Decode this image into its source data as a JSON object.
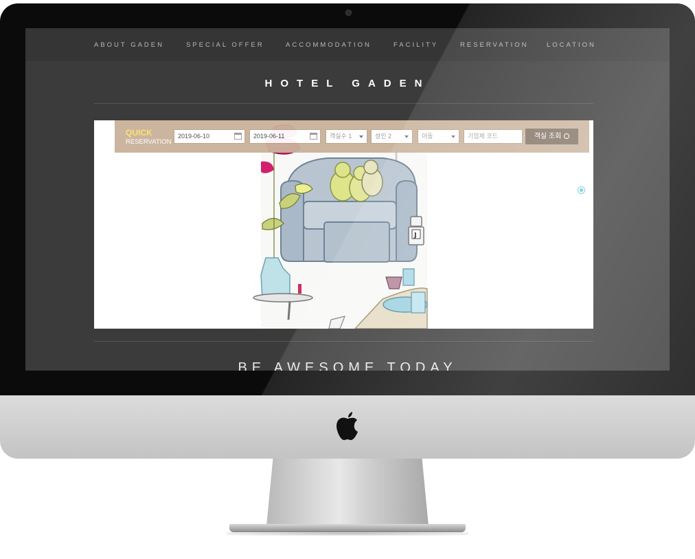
{
  "nav": {
    "items": [
      "ABOUT GADEN",
      "SPECIAL OFFER",
      "ACCOMMODATION",
      "FACILITY",
      "RESERVATION",
      "LOCATION"
    ]
  },
  "brand": {
    "title": "HOTEL GADEN"
  },
  "quick_reservation": {
    "title": "QUICK",
    "subtitle": "RESERVATION",
    "checkin": "2019-06-10",
    "checkout": "2019-06-11",
    "rooms": "객실수 1",
    "adults": "성인 2",
    "children": "아동",
    "corp_code_placeholder": "기업체 코드",
    "search_label": "객실 조회"
  },
  "tagline": "BE AWESOME TODAY",
  "colors": {
    "accent_yellow": "#fbe26e",
    "reservation_bar": "#c9b29a",
    "search_button": "#7f6f5f",
    "screen_bg": "#3b3b3b"
  },
  "icons": [
    "camera-icon",
    "calendar-icon",
    "dropdown-caret-icon",
    "search-icon",
    "apple-logo-icon",
    "slider-bullet-icon"
  ]
}
